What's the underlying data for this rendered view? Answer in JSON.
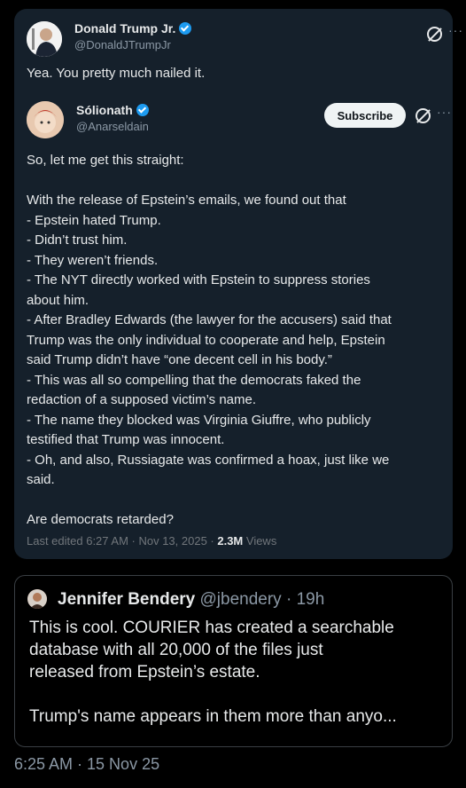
{
  "reply": {
    "author_name": "Donald Trump Jr.",
    "author_handle": "@DonaldJTrumpJr",
    "text": "Yea. You pretty much nailed it."
  },
  "original": {
    "author_name": "Sólionath",
    "author_handle": "@Anarseldain",
    "subscribe_label": "Subscribe",
    "lines": [
      "So, let me get this straight:",
      "",
      "With the release of Epstein’s emails, we found out that",
      " - Epstein hated Trump.",
      " - Didn’t trust him.",
      " - They weren’t friends.",
      " - The NYT directly worked with Epstein to suppress stories",
      "about him.",
      " - After Bradley Edwards (the lawyer for the accusers) said that",
      "Trump was the only individual to cooperate and help, Epstein",
      "said Trump didn’t have “one decent cell in his body.”",
      " - This was all so compelling that the democrats faked the",
      "redaction of a supposed victim’s name.",
      " - The name they blocked was Virginia Giuffre, who publicly",
      "testified that Trump was innocent.",
      " - Oh, and also, Russiagate was confirmed a hoax, just like we",
      "said.",
      "",
      "Are democrats retarded?"
    ],
    "edited": "Last edited 6:27 AM · Nov 13, 2025 · ",
    "views_count": "2.3M",
    "views_label": " Views"
  },
  "quote": {
    "author_name": "Jennifer Bendery",
    "author_handle": " @jbendery · 19h",
    "lines": [
      "This is cool. COURIER has created a searchable",
      "database with all 20,000 of the files just",
      "released from Epstein’s estate.",
      "",
      "Trump's name appears in them more than anyo..."
    ]
  },
  "timestamp": "6:25 AM · 15 Nov 25",
  "icons": {
    "more": "···"
  },
  "colors": {
    "card_bg": "#15202b",
    "verified": "#1d9bf0",
    "muted": "#8b98a5"
  }
}
